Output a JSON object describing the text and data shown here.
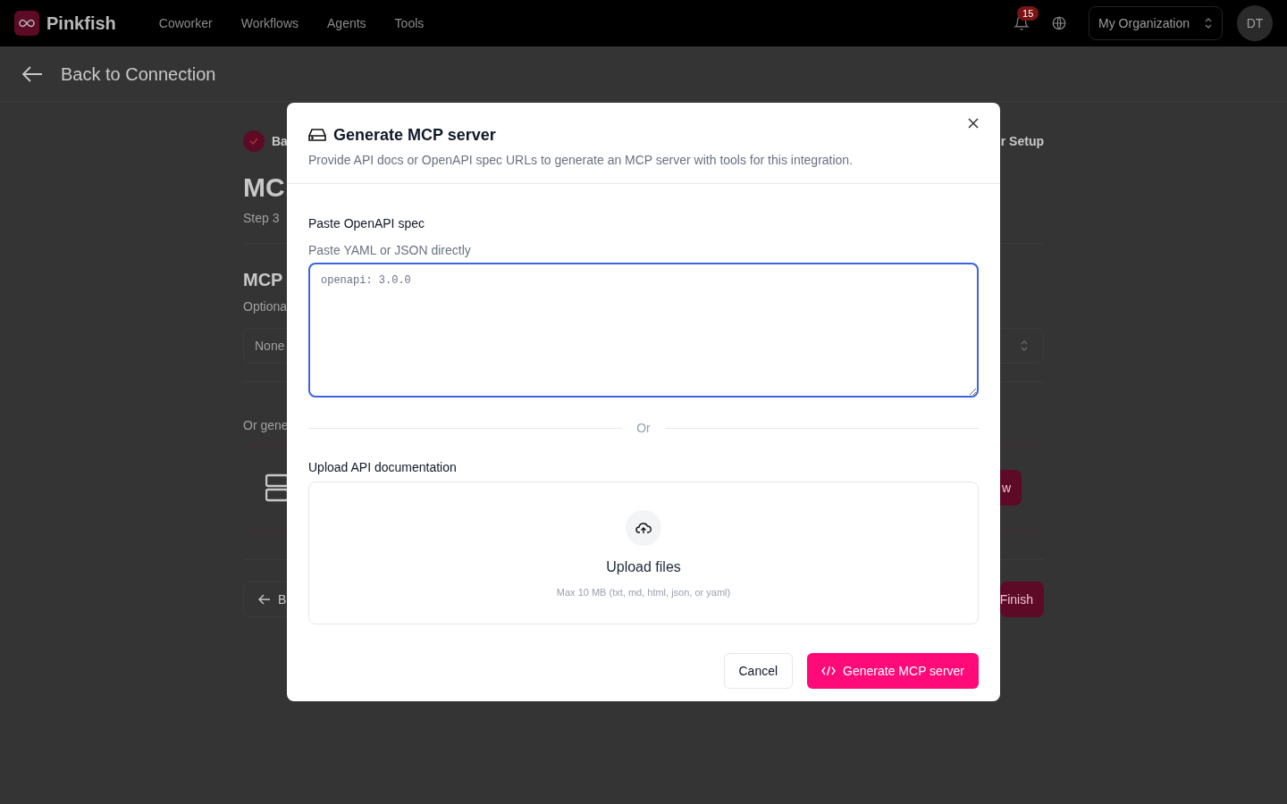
{
  "nav": {
    "brand": "Pinkfish",
    "links": [
      {
        "label": "Coworker",
        "selected": false
      },
      {
        "label": "Workflows",
        "selected": false
      },
      {
        "label": "Agents",
        "selected": false
      },
      {
        "label": "Tools",
        "selected": false
      }
    ],
    "notifications": "15",
    "organization": "My Organization",
    "avatar": "DT"
  },
  "back_link": "Back to Connection",
  "background": {
    "step_left": "Ba",
    "step_right": "r Setup",
    "title": "MC",
    "step_text": "Step 3",
    "section_title": "MCP",
    "section_hint": "Optiona",
    "select_value": "None",
    "generate_hint": "Or gene",
    "generate_button": "w",
    "back_button": "B",
    "finish_button": "Finish"
  },
  "dialog": {
    "title": "Generate MCP server",
    "subtitle": "Provide API docs or OpenAPI spec URLs to generate an MCP server with tools for this integration.",
    "spec_label": "Paste OpenAPI spec",
    "spec_hint": "Paste YAML or JSON directly",
    "spec_placeholder": "openapi: 3.0.0",
    "divider": "Or",
    "upload_label": "Upload API documentation",
    "upload_title": "Upload files",
    "upload_hint": "Max 10 MB (txt, md, html, json, or yaml)",
    "buttons": [
      {
        "label": "Cancel",
        "kind": "secondary"
      },
      {
        "label": "Generate MCP server",
        "kind": "primary"
      }
    ]
  }
}
